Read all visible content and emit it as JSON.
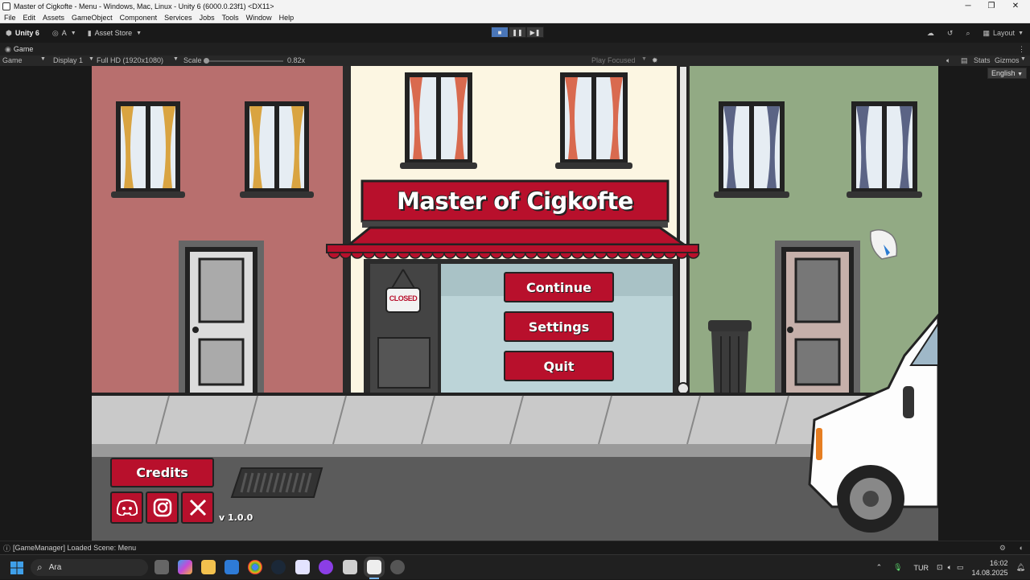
{
  "window": {
    "title": "Master of Cigkofte - Menu - Windows, Mac, Linux - Unity 6 (6000.0.23f1) <DX11>",
    "controls": [
      "─",
      "❐",
      "✕"
    ]
  },
  "menu": [
    "File",
    "Edit",
    "Assets",
    "GameObject",
    "Component",
    "Services",
    "Jobs",
    "Tools",
    "Window",
    "Help"
  ],
  "toolbar": {
    "unity_label": "Unity 6",
    "account_label": "A",
    "asset_store_label": "Asset Store",
    "layout_label": "Layout"
  },
  "tab": {
    "label": "Game"
  },
  "game_bar": {
    "mode": "Game",
    "display": "Display 1",
    "resolution": "Full HD (1920x1080)",
    "scale_label": "Scale",
    "scale_value": "0.82x",
    "play_mode": "Play Focused",
    "stats": "Stats",
    "gizmos": "Gizmos"
  },
  "game": {
    "title": "Master of Cigkofte",
    "buttons": [
      "Continue",
      "Settings",
      "Quit"
    ],
    "credits_label": "Credits",
    "version": "v 1.0.0",
    "closed_sign": "CLOSED",
    "language": "English",
    "social": [
      "discord-icon",
      "instagram-icon",
      "x-icon"
    ]
  },
  "status": {
    "message": "[GameManager] Loaded Scene: Menu"
  },
  "taskbar": {
    "search_placeholder": "Ara",
    "language": "TUR",
    "time": "16:02",
    "date": "14.08.2025"
  },
  "colors": {
    "brand_red": "#b8102c",
    "left_wall": "#b86f6e",
    "mid_wall": "#fcf6e2",
    "right_wall": "#92aa84",
    "unity_play_active": "#4a76b8"
  }
}
